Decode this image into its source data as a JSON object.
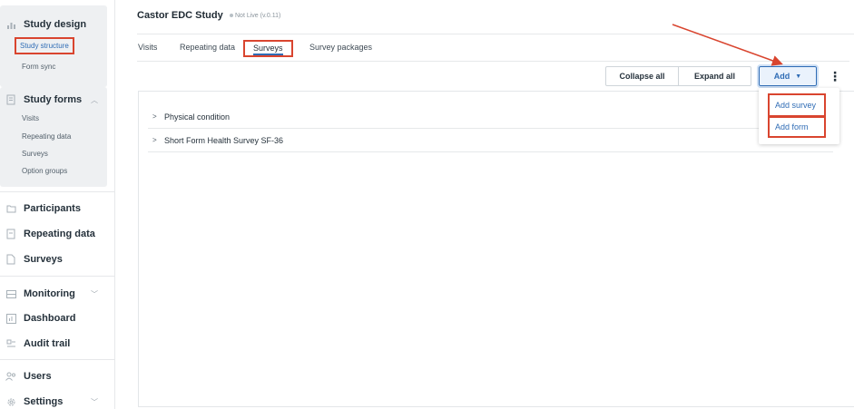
{
  "sidebar": {
    "study_design": {
      "label": "Study design",
      "icon": "bar-chart-icon"
    },
    "study_structure": "Study structure",
    "form_sync": "Form sync",
    "study_forms": {
      "label": "Study forms",
      "icon": "document-icon"
    },
    "study_forms_items": [
      "Visits",
      "Repeating data",
      "Surveys",
      "Option groups"
    ],
    "main_items": [
      {
        "label": "Participants",
        "icon": "folder-icon"
      },
      {
        "label": "Repeating data",
        "icon": "document-icon"
      },
      {
        "label": "Surveys",
        "icon": "document-icon"
      },
      {
        "label": "Monitoring",
        "icon": "monitoring-icon"
      },
      {
        "label": "Dashboard",
        "icon": "chart-icon"
      },
      {
        "label": "Audit trail",
        "icon": "audit-icon"
      },
      {
        "label": "Users",
        "icon": "users-icon"
      },
      {
        "label": "Settings",
        "icon": "gear-icon"
      }
    ]
  },
  "header": {
    "title": "Castor EDC Study",
    "status": "Not Live (v.0.11)"
  },
  "tabs": [
    "Visits",
    "Repeating data",
    "Surveys",
    "Survey packages"
  ],
  "toolbar": {
    "collapse": "Collapse all",
    "expand": "Expand all",
    "add": "Add"
  },
  "add_menu": [
    "Add survey",
    "Add form"
  ],
  "surveys": [
    "Physical condition",
    "Short Form Health Survey SF-36"
  ],
  "colors": {
    "highlight": "#d9452f",
    "accent": "#2f6cb5"
  }
}
